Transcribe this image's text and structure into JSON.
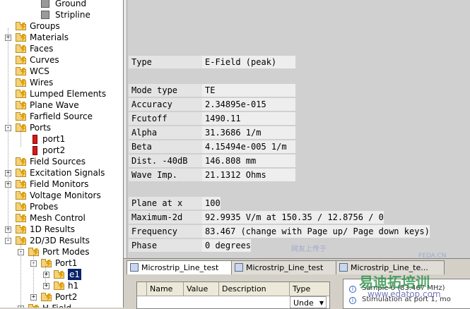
{
  "tree": {
    "items": [
      {
        "label": "Ground",
        "icon": "gear-solid-icon",
        "level": 3,
        "expander": ""
      },
      {
        "label": "Stripline",
        "icon": "gear-solid-icon",
        "level": 3,
        "expander": ""
      },
      {
        "label": "Groups",
        "icon": "folder-icon",
        "level": 1,
        "expander": ""
      },
      {
        "label": "Materials",
        "icon": "folder-icon",
        "level": 1,
        "expander": "+"
      },
      {
        "label": "Faces",
        "icon": "folder-icon",
        "level": 1,
        "expander": ""
      },
      {
        "label": "Curves",
        "icon": "folder-icon",
        "level": 1,
        "expander": ""
      },
      {
        "label": "WCS",
        "icon": "folder-icon",
        "level": 1,
        "expander": ""
      },
      {
        "label": "Wires",
        "icon": "folder-icon",
        "level": 1,
        "expander": ""
      },
      {
        "label": "Lumped Elements",
        "icon": "folder-icon",
        "level": 1,
        "expander": ""
      },
      {
        "label": "Plane Wave",
        "icon": "folder-icon",
        "level": 1,
        "expander": ""
      },
      {
        "label": "Farfield Source",
        "icon": "folder-icon",
        "level": 1,
        "expander": ""
      },
      {
        "label": "Ports",
        "icon": "folder-icon",
        "level": 1,
        "expander": "-"
      },
      {
        "label": "port1",
        "icon": "port-icon",
        "level": 2,
        "expander": ""
      },
      {
        "label": "port2",
        "icon": "port-icon",
        "level": 2,
        "expander": ""
      },
      {
        "label": "Field Sources",
        "icon": "folder-icon",
        "level": 1,
        "expander": ""
      },
      {
        "label": "Excitation Signals",
        "icon": "folder-icon",
        "level": 1,
        "expander": "+"
      },
      {
        "label": "Field Monitors",
        "icon": "folder-icon",
        "level": 1,
        "expander": "+"
      },
      {
        "label": "Voltage Monitors",
        "icon": "folder-icon",
        "level": 1,
        "expander": ""
      },
      {
        "label": "Probes",
        "icon": "folder-icon",
        "level": 1,
        "expander": ""
      },
      {
        "label": "Mesh Control",
        "icon": "folder-icon",
        "level": 1,
        "expander": ""
      },
      {
        "label": "1D Results",
        "icon": "folder-icon",
        "level": 1,
        "expander": "+"
      },
      {
        "label": "2D/3D Results",
        "icon": "folder-icon",
        "level": 1,
        "expander": "-"
      },
      {
        "label": "Port Modes",
        "icon": "folder-icon",
        "level": 2,
        "expander": "-"
      },
      {
        "label": "Port1",
        "icon": "folder-icon",
        "level": 3,
        "expander": "-"
      },
      {
        "label": "e1",
        "icon": "folder-icon",
        "level": 4,
        "expander": "+",
        "selected": true
      },
      {
        "label": "h1",
        "icon": "folder-icon",
        "level": 4,
        "expander": "+"
      },
      {
        "label": "Port2",
        "icon": "folder-icon",
        "level": 3,
        "expander": "+"
      },
      {
        "label": "H-Field",
        "icon": "folder-icon",
        "level": 2,
        "expander": "+"
      }
    ]
  },
  "info": {
    "type_rows": [
      {
        "k": "Type",
        "v": "E-Field (peak)"
      }
    ],
    "mode_rows": [
      {
        "k": "Mode type",
        "v": "TE"
      },
      {
        "k": "Accuracy",
        "v": "2.34895e-015"
      },
      {
        "k": "Fcutoff",
        "v": "1490.11"
      },
      {
        "k": "Alpha",
        "v": "31.3686 1/m"
      },
      {
        "k": "Beta",
        "v": "4.15494e-005 1/m"
      },
      {
        "k": "Dist. -40dB",
        "v": "146.808 mm"
      },
      {
        "k": "Wave Imp.",
        "v": "21.1312 Ohms"
      }
    ],
    "plane_rows": [
      {
        "k": "Plane at x",
        "v": "100"
      },
      {
        "k": "Maximum-2d",
        "v": "92.9935 V/m at 150.35 / 12.8756 / 0"
      },
      {
        "k": "Frequency",
        "v": "83.467 (change with Page up/ Page down keys)"
      },
      {
        "k": "Phase",
        "v": "0 degrees"
      }
    ]
  },
  "tabs": [
    {
      "label": "Microstrip_Line_test",
      "active": true
    },
    {
      "label": "Microstrip_Line_test",
      "active": false
    },
    {
      "label": "Microstrip_Line_te...",
      "active": false
    }
  ],
  "param_grid": {
    "columns": [
      "Name",
      "Value",
      "Description",
      "Type"
    ],
    "type_value": "Unde"
  },
  "messages": [
    "Sample 6 (83.467 MHz)",
    "Stimulation at port 1, mo"
  ],
  "watermark": {
    "line1": "网友上传于",
    "line2": "FEDA.CN",
    "line3": "易迪拓培训",
    "line4": "www.edatop.com"
  },
  "colors": {
    "selection": "#0a246a",
    "shape_fill": "#efcbbd",
    "shape_line": "#8b1f6b"
  }
}
